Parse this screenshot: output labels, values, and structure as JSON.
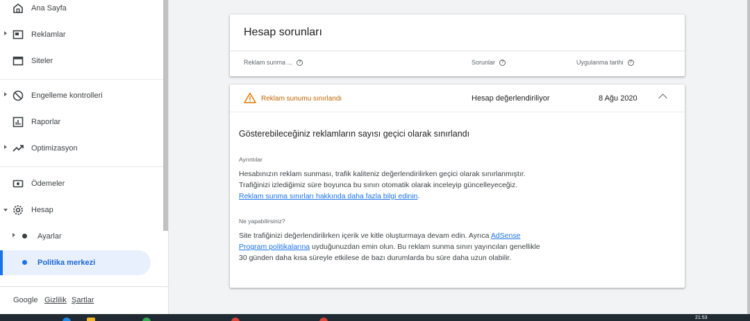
{
  "sidebar": {
    "items": [
      {
        "label": "Ana Sayfa",
        "icon": "home-icon"
      },
      {
        "label": "Reklamlar",
        "icon": "ads-icon"
      },
      {
        "label": "Siteler",
        "icon": "sites-icon"
      },
      {
        "label": "Engelleme kontrolleri",
        "icon": "block-icon"
      },
      {
        "label": "Raporlar",
        "icon": "reports-icon"
      },
      {
        "label": "Optimizasyon",
        "icon": "optimization-icon"
      },
      {
        "label": "Ödemeler",
        "icon": "payments-icon"
      },
      {
        "label": "Hesap",
        "icon": "gear-icon"
      }
    ],
    "sub_items": [
      {
        "label": "Ayarlar"
      },
      {
        "label": "Politika merkezi",
        "active": true
      }
    ],
    "footer": {
      "brand": "Google",
      "privacy": "Gizlilik",
      "terms": "Şartlar"
    }
  },
  "header_card": {
    "title": "Hesap sorunları",
    "columns": [
      "Reklam sunma ...",
      "Sorunlar",
      "Uygulanma tarihi"
    ]
  },
  "detail_card": {
    "status": "Reklam sunumu sınırlandı",
    "issue": "Hesap değerlendiriliyor",
    "date": "8 Ağu 2020",
    "title": "Gösterebileceğiniz reklamların sayısı geçici olarak sınırlandı",
    "details_label": "Ayrıntılar",
    "details_line1": "Hesabınızın reklam sunması, trafik kaliteniz değerlendirilirken geçici olarak sınırlanmıştır.",
    "details_line2": "Trafiğinizi izlediğimiz süre boyunca bu sınırı otomatik olarak inceleyip güncelleyeceğiz.",
    "details_link": "Reklam sunma sınırları hakkında daha fazla bilgi edinin",
    "details_link_suffix": ".",
    "todo_label": "Ne yapabilirsiniz?",
    "todo_text_before": "Site trafiğinizi değerlendirilirken içerik ve kitle oluşturmaya devam edin. Ayrıca ",
    "todo_link": "AdSense Program politikalarına",
    "todo_text_after": " uyduğunuzdan emin olun. Bu reklam sunma sınırı yayıncıları genellikle 30 günden daha kısa süreyle etkilese de bazı durumlarda bu süre daha uzun olabilir."
  },
  "taskbar": {
    "time": "21:53"
  },
  "colors": {
    "accent": "#1a73e8",
    "warning": "#e37400"
  }
}
